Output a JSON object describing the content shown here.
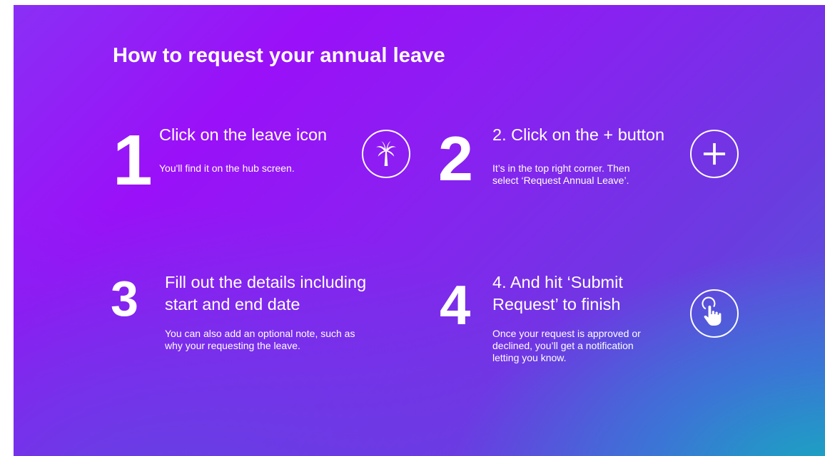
{
  "title": "How to request your annual leave",
  "steps": [
    {
      "number": "1",
      "heading": "Click on the leave icon",
      "description": "You'll find it on the hub screen.",
      "icon": "palm-tree-icon"
    },
    {
      "number": "2",
      "heading": "2. Click on the + button",
      "description_lines": [
        "It’s in the top right corner. Then",
        "select ‘Request Annual Leave’."
      ],
      "icon": "plus-icon"
    },
    {
      "number": "3",
      "heading_lines": [
        "Fill out the details including",
        "start and end date"
      ],
      "description_lines": [
        "You can also add an optional note, such as",
        "why your requesting the leave."
      ]
    },
    {
      "number": "4",
      "heading_lines": [
        "4. And hit ‘Submit",
        "Request’ to finish"
      ],
      "description_lines": [
        "Once your request is approved or",
        "declined, you’ll get a notification",
        "letting you know."
      ],
      "icon": "tap-hand-icon"
    }
  ],
  "colors": {
    "background_start": "#8a2ff5",
    "background_mid": "#9a10f8",
    "background_end": "#1aa8c0",
    "text": "#ffffff"
  }
}
